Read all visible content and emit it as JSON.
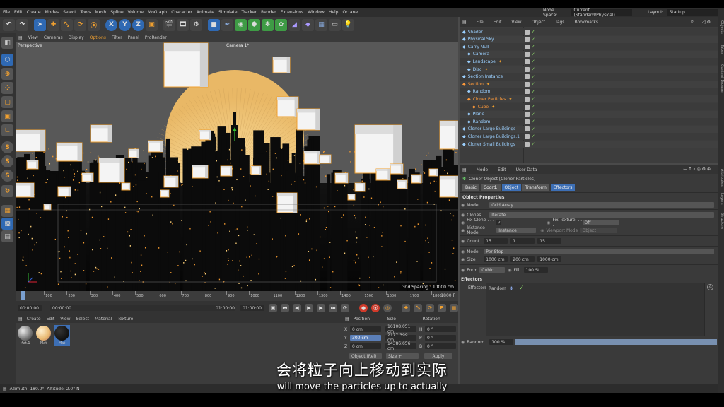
{
  "menu": [
    "File",
    "Edit",
    "Create",
    "Modes",
    "Select",
    "Tools",
    "Mesh",
    "Spline",
    "Volume",
    "MoGraph",
    "Character",
    "Animate",
    "Simulate",
    "Tracker",
    "Render",
    "Extensions",
    "Window",
    "Help",
    "Octane"
  ],
  "node_space": {
    "label": "Node Space:",
    "value": "Current (Standard/Physical)"
  },
  "layout": {
    "label": "Layout:",
    "value": "Startup"
  },
  "toolbar_glyphs": [
    "X",
    "Y",
    "Z"
  ],
  "viewport": {
    "menu": [
      "View",
      "Cameras",
      "Display",
      "Options",
      "Filter",
      "Panel",
      "ProRender"
    ],
    "label": "Perspective",
    "camera": "Camera 1*",
    "grid_spacing": "Grid Spacing : 10000 cm",
    "colors": {
      "sky": "#585858",
      "sun": "#f3cf88",
      "city": "#0c0c0c",
      "light": "#f29a30"
    }
  },
  "timeline": {
    "ticks": [
      "0",
      "100",
      "200",
      "300",
      "400",
      "500",
      "600",
      "700",
      "800",
      "900",
      "1000",
      "1100",
      "1200",
      "1300",
      "1400",
      "1500",
      "1600",
      "1700",
      "1800"
    ],
    "end_frame": "1800 F",
    "current": "0 F",
    "fields": [
      "00:00:00",
      "00:00:00",
      "01:00:00",
      "01:00:00"
    ]
  },
  "materials": {
    "menu": [
      "Create",
      "Edit",
      "View",
      "Select",
      "Material",
      "Texture"
    ],
    "items": [
      "Mat.1",
      "Mat",
      "Mat"
    ]
  },
  "coords": {
    "headers": [
      "Position",
      "Size",
      "Rotation"
    ],
    "rows": [
      {
        "axis": "X",
        "pos": "0 cm",
        "size": "16108.051 cm",
        "rot_axis": "H",
        "rot": "0 °"
      },
      {
        "axis": "Y",
        "pos": "300 cm",
        "size": "2177.399 cm",
        "rot_axis": "P",
        "rot": "0 °"
      },
      {
        "axis": "Z",
        "pos": "0 cm",
        "size": "14386.656 cm",
        "rot_axis": "B",
        "rot": "0 °"
      }
    ],
    "mode_select": "Object (Rel)",
    "size_select": "Size +",
    "apply": "Apply"
  },
  "status": "Azimuth: 180.0°, Altitude: 2.0°  N",
  "object_manager": {
    "menu": [
      "File",
      "Edit",
      "View",
      "Object",
      "Tags",
      "Bookmarks"
    ],
    "objects": [
      {
        "name": "Shader",
        "indent": 0,
        "color": "#9bd0ff"
      },
      {
        "name": "Physical Sky",
        "indent": 0,
        "color": "#9bd0ff"
      },
      {
        "name": "Carry Null",
        "indent": 0,
        "color": "#9bd0ff"
      },
      {
        "name": "Camera",
        "indent": 1,
        "color": "#9bd0ff"
      },
      {
        "name": "Landscape",
        "indent": 1,
        "color": "#9bd0ff"
      },
      {
        "name": "Disc",
        "indent": 1,
        "color": "#9bd0ff"
      },
      {
        "name": "Section Instance",
        "indent": 0,
        "color": "#9bd0ff"
      },
      {
        "name": "Section",
        "indent": 0,
        "color": "#ff9a3a"
      },
      {
        "name": "Random",
        "indent": 1,
        "color": "#9bd0ff"
      },
      {
        "name": "Cloner Particles",
        "indent": 1,
        "color": "#ff9a3a"
      },
      {
        "name": "Cube",
        "indent": 2,
        "color": "#ff9a3a"
      },
      {
        "name": "Plane",
        "indent": 1,
        "color": "#9bd0ff"
      },
      {
        "name": "Random",
        "indent": 1,
        "color": "#9bd0ff"
      },
      {
        "name": "Cloner Large Buildings",
        "indent": 0,
        "color": "#9bd0ff"
      },
      {
        "name": "Cloner Large Buildings.1",
        "indent": 0,
        "color": "#9bd0ff"
      },
      {
        "name": "Cloner Small Buildings",
        "indent": 0,
        "color": "#9bd0ff"
      }
    ]
  },
  "attributes": {
    "menu": [
      "Mode",
      "Edit",
      "User Data"
    ],
    "title": "Cloner Object [Cloner Particles]",
    "tabs": [
      "Basic",
      "Coord.",
      "Object",
      "Transform",
      "Effectors"
    ],
    "active_tab": "Object",
    "section": "Object Properties",
    "mode": {
      "label": "Mode",
      "value": "Grid Array"
    },
    "clones": {
      "label": "Clones",
      "value": "Iterate"
    },
    "fix_clone": {
      "label": "Fix Clone . . . . .",
      "checked": true
    },
    "fix_texture": {
      "label": "Fix Texture. . . .",
      "value": "Off"
    },
    "instance_mode": {
      "label": "Instance Mode",
      "value": "Instance"
    },
    "viewport_mode": {
      "label": "Viewport Mode",
      "value": "Object"
    },
    "count": {
      "label": "Count",
      "values": [
        "15",
        "1",
        "15"
      ]
    },
    "mode2": {
      "label": "Mode",
      "value": "Per-Step"
    },
    "size": {
      "label": "Size",
      "values": [
        "1000 cm",
        "200 cm",
        "1000 cm"
      ]
    },
    "form": {
      "label": "Form",
      "value": "Cubic"
    },
    "fill": {
      "label": "Fill",
      "value": "100 %"
    },
    "effectors_section": "Effectors",
    "effectors_label": "Effectors",
    "effector_item": "Random",
    "random": {
      "label": "Random",
      "value": "100 %"
    }
  },
  "right_strip": [
    "Objects",
    "Takes",
    "Content Browser",
    "Attributes",
    "Layers",
    "Structure"
  ],
  "subtitle": {
    "zh": "会将粒子向上移动到实际",
    "en": "will move the particles up to actually"
  }
}
